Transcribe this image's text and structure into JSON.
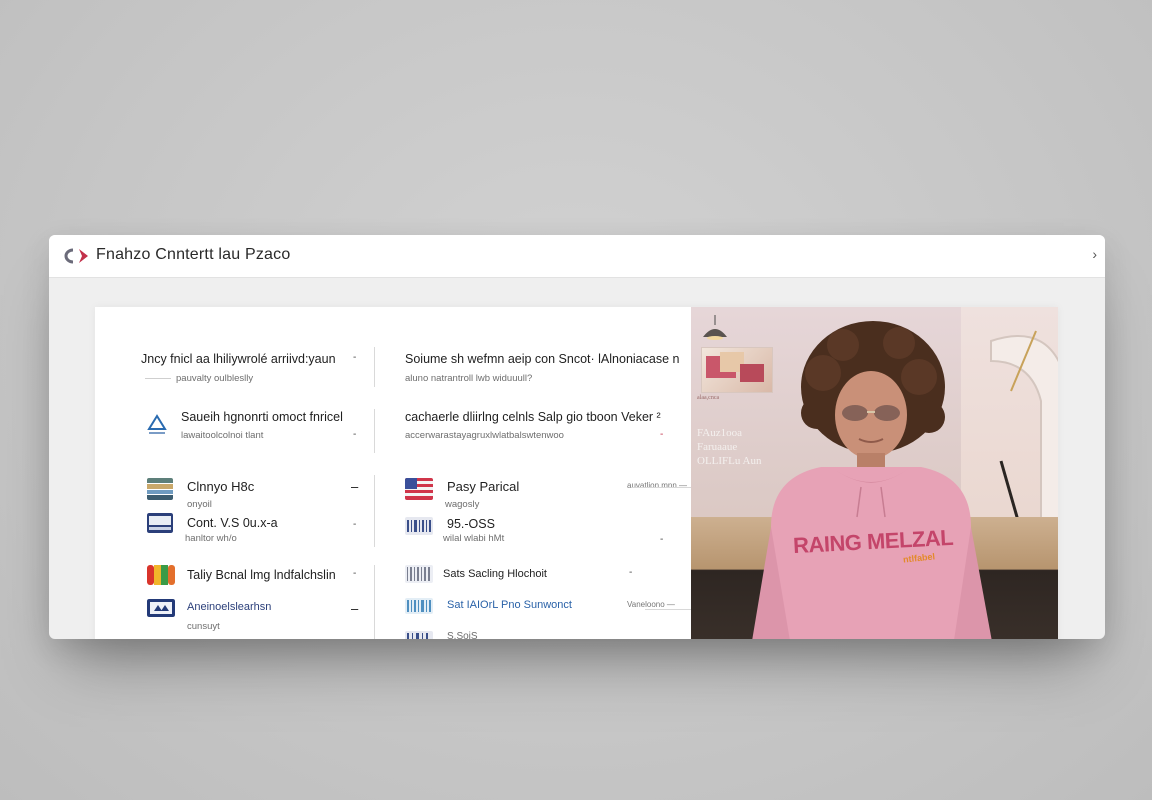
{
  "window": {
    "title": "Fnahzo Cnntertt lau Pzaco",
    "chevron": "›"
  },
  "colors": {
    "accent": "#c2314a",
    "logo_gray": "#6b6b7a",
    "hoodie": "#e7a2b6",
    "hoodie_text": "#c4456a"
  },
  "left_column": [
    {
      "title": "Jncy fnicl aa lhiliywrolé arriivd:yaun",
      "subtitle": "pauvalty oulbleslly",
      "icon": "none",
      "mark": "-"
    },
    {
      "title": "Saueih hgnonrti omoct fnricel",
      "subtitle": "lawaitoolcolnoi tlant",
      "icon": "delta-icon",
      "mark": "-"
    },
    {
      "title": "Clnnyo H8c",
      "subtitle": "onyoil",
      "icon": "book-stack-icon",
      "mark": "–"
    },
    {
      "title": "Cont. V.S 0u.x-a",
      "subtitle": "hanltor wh/o",
      "icon": "card-icon",
      "mark": "-"
    },
    {
      "title": "Taliy Bcnal lmg lndfalchslin",
      "subtitle": "",
      "icon": "rainbow-icon",
      "mark": "-"
    },
    {
      "title": "Aneinoelslearhsn",
      "subtitle": "cunsuyt",
      "icon": "bank-card-icon",
      "mark": "–"
    }
  ],
  "right_column": [
    {
      "title": "Soiume sh wefmn aeip con Sncot· lAlnoniacase n",
      "subtitle": "aluno natrantroll lwb widuuull?",
      "icon": "none",
      "mark": ""
    },
    {
      "title": "cachaerle dliirlng celnls Salp gio tboon Veker ²",
      "subtitle": "accerwarastayagruxlwlatbalswtenwoo",
      "icon": "none",
      "mark": "-"
    },
    {
      "title": "Pasy Parical",
      "subtitle": "wagosly",
      "icon": "flag-icon",
      "mark": "auvatlion mnn —"
    },
    {
      "title": "95.-OSS",
      "subtitle": "wilal wlabi hMt",
      "icon": "barcode-icon",
      "mark": "-"
    },
    {
      "title": "Sats Sacling Hlochoit",
      "subtitle": "",
      "icon": "barcode-icon",
      "mark": "-"
    },
    {
      "title": "Sat IAIOrL Pno Sunwonct",
      "subtitle": "",
      "icon": "barcode-icon",
      "mark": "Vaneloono —"
    },
    {
      "title": "S.SoiS",
      "subtitle": "",
      "icon": "barcode-icon",
      "mark": ""
    }
  ],
  "promo": {
    "side_text_1": "alaa,cnca",
    "side_text_2": "FAuz1ooa",
    "side_text_3": "Faruaaue",
    "side_text_4": "OLLIFLu Aun",
    "hoodie_text": "RAING MELZAL",
    "hoodie_sub": "ntlfabel"
  }
}
